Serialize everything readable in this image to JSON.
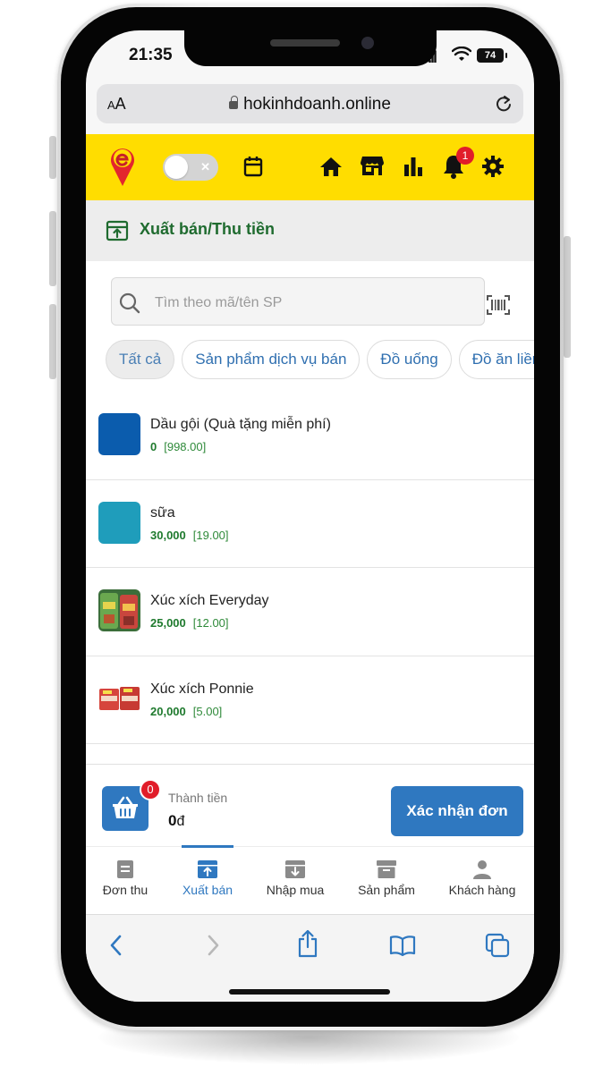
{
  "status": {
    "time": "21:35",
    "battery": "74"
  },
  "browser": {
    "text_size_label": "AA",
    "url": "hokinhdoanh.online"
  },
  "header": {
    "notification_count": "1"
  },
  "page": {
    "title": "Xuất bán/Thu tiền"
  },
  "search": {
    "placeholder": "Tìm theo mã/tên SP"
  },
  "categories": [
    "Tất cả",
    "Sản phẩm dịch vụ bán",
    "Đồ uống",
    "Đồ ăn liền"
  ],
  "products": [
    {
      "name": "Dầu gội (Quà tặng miễn phí)",
      "price": "0",
      "stock": "[998.00]",
      "thumb_color": "#0b5cad"
    },
    {
      "name": "sữa",
      "price": "30,000",
      "stock": "[19.00]",
      "thumb_color": "#1f9dbb"
    },
    {
      "name": "Xúc xích Everyday",
      "price": "25,000",
      "stock": "[12.00]",
      "thumb_color": "#c24a3a"
    },
    {
      "name": "Xúc xích Ponnie",
      "price": "20,000",
      "stock": "[5.00]",
      "thumb_color": "#d6453c"
    }
  ],
  "checkout": {
    "cart_count": "0",
    "total_label": "Thành tiền",
    "total_value": "0",
    "currency": "đ",
    "confirm_label": "Xác nhận đơn"
  },
  "tabs": [
    {
      "label": "Đơn thu",
      "icon": "receipt-icon"
    },
    {
      "label": "Xuất bán",
      "icon": "export-box-icon"
    },
    {
      "label": "Nhập mua",
      "icon": "import-box-icon"
    },
    {
      "label": "Sản phẩm",
      "icon": "archive-icon"
    },
    {
      "label": "Khách hàng",
      "icon": "user-icon"
    }
  ],
  "colors": {
    "header_yellow": "#ffdd00",
    "primary_blue": "#2f78c0",
    "price_green": "#1f7a2e",
    "badge_red": "#e11d2a",
    "title_green": "#1f6b2f"
  }
}
